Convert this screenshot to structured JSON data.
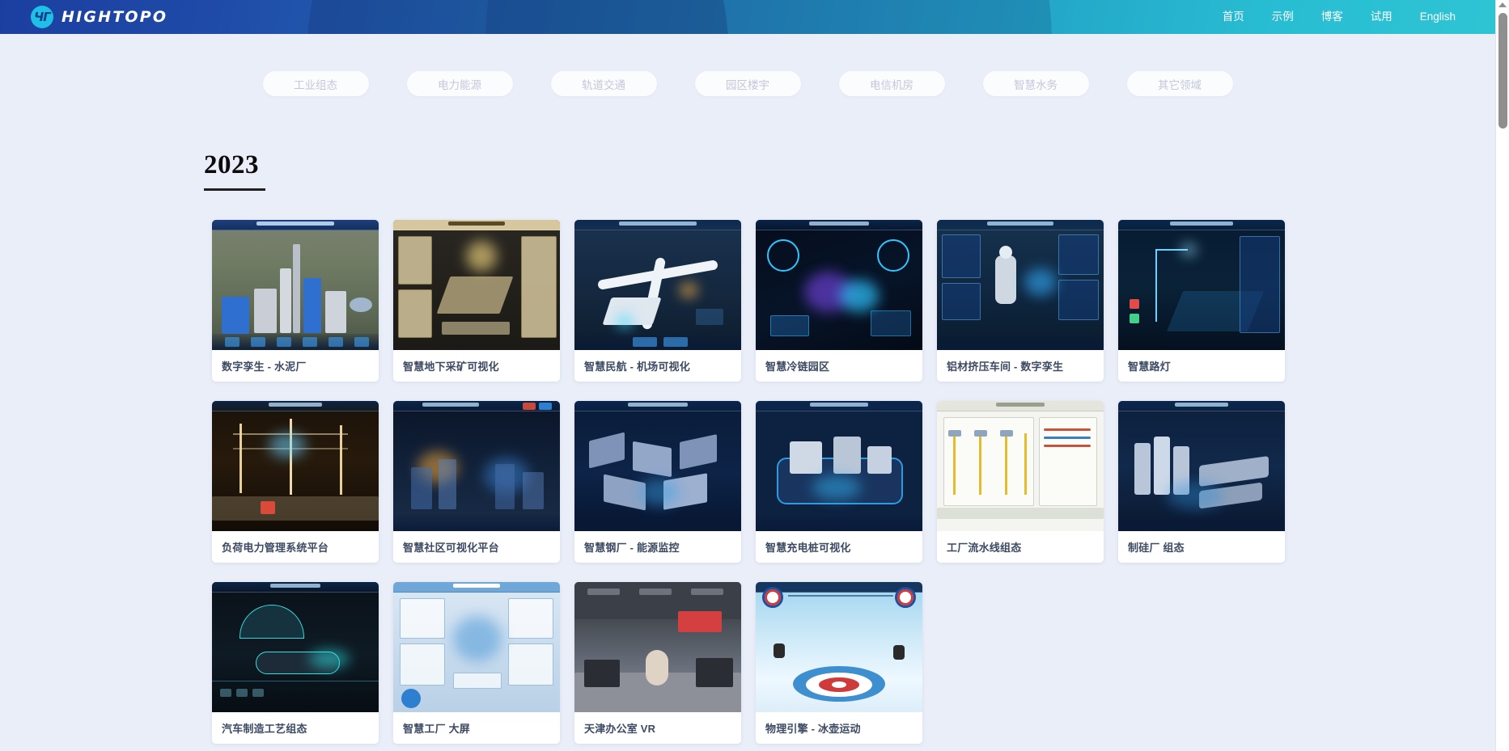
{
  "header": {
    "logo_mark": "ht-logo-icon",
    "brand": "HIGHTOPO",
    "nav": [
      {
        "label": "首页"
      },
      {
        "label": "示例"
      },
      {
        "label": "博客"
      },
      {
        "label": "试用"
      },
      {
        "label": "English"
      }
    ],
    "gradient_from": "#1b3fa0",
    "gradient_to": "#2ec4d4"
  },
  "filters": [
    {
      "label": "工业组态"
    },
    {
      "label": "电力能源"
    },
    {
      "label": "轨道交通"
    },
    {
      "label": "园区楼宇"
    },
    {
      "label": "电信机房"
    },
    {
      "label": "智慧水务"
    },
    {
      "label": "其它领域"
    }
  ],
  "section": {
    "year": "2023"
  },
  "cards": [
    {
      "title": "数字孪生 - 水泥厂",
      "scene": "cement-plant"
    },
    {
      "title": "智慧地下采矿可视化",
      "scene": "underground-mining"
    },
    {
      "title": "智慧民航 - 机场可视化",
      "scene": "airport"
    },
    {
      "title": "智慧冷链园区",
      "scene": "cold-chain"
    },
    {
      "title": "铝材挤压车间 - 数字孪生",
      "scene": "aluminium-workshop"
    },
    {
      "title": "智慧路灯",
      "scene": "smart-streetlight"
    },
    {
      "title": "负荷电力管理系统平台",
      "scene": "power-load"
    },
    {
      "title": "智慧社区可视化平台",
      "scene": "smart-community"
    },
    {
      "title": "智慧钢厂 - 能源监控",
      "scene": "steel-plant"
    },
    {
      "title": "智慧充电桩可视化",
      "scene": "charging-pile"
    },
    {
      "title": "工厂流水线组态",
      "scene": "assembly-line"
    },
    {
      "title": "制硅厂 组态",
      "scene": "silicon-plant"
    },
    {
      "title": "汽车制造工艺组态",
      "scene": "auto-manufacturing"
    },
    {
      "title": "智慧工厂 大屏",
      "scene": "factory-dashboard"
    },
    {
      "title": "天津办公室 VR",
      "scene": "office-vr"
    },
    {
      "title": "物理引擎 - 冰壶运动",
      "scene": "curling-physics"
    }
  ],
  "scrollbar": {
    "arrow_icon": "triangle-up-icon"
  },
  "colors": {
    "page_bg": "#eaeef8",
    "card_bg": "#ffffff",
    "title_text": "#3c4a63",
    "chip_text": "#c2c8da"
  }
}
